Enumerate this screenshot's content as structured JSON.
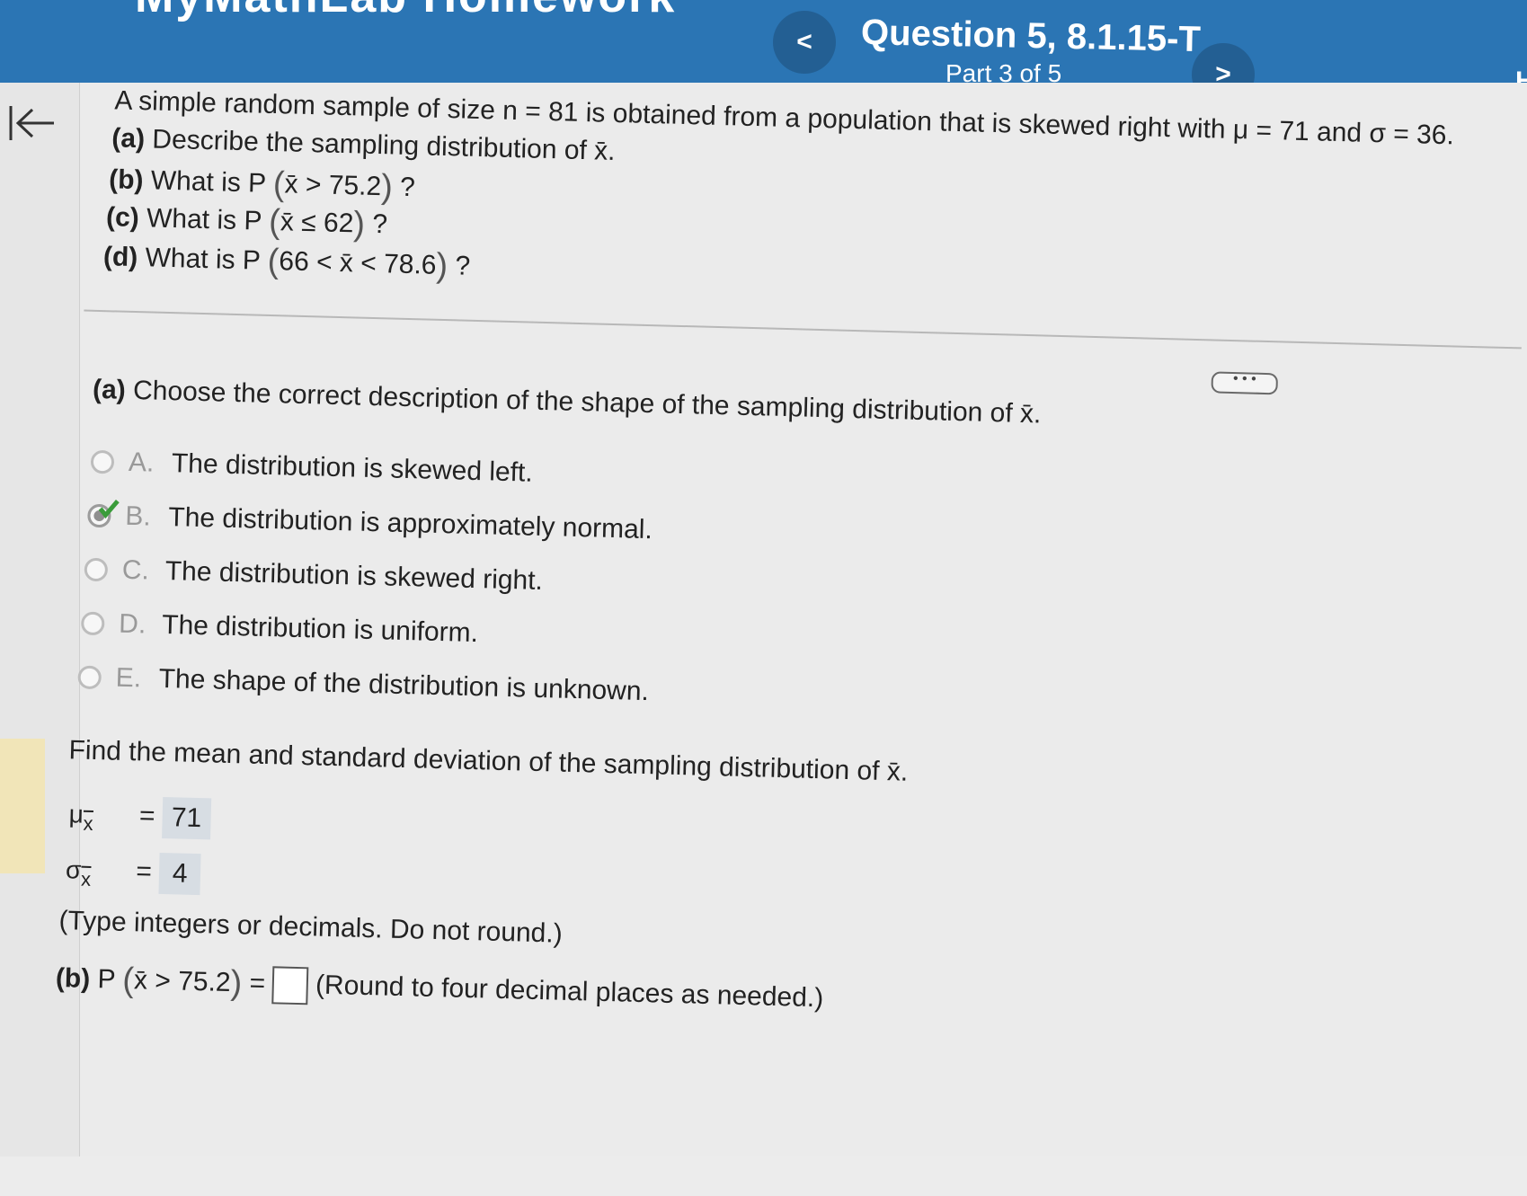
{
  "header": {
    "brand": "MyMathLab Homework",
    "question_title": "Question 5, 8.1.15-T",
    "part_label": "Part 3 of 5",
    "prev_label": "<",
    "next_label": ">",
    "corner_text": "H"
  },
  "problem": {
    "intro": "A simple random sample of size n = 81 is obtained from a population that is skewed right with μ = 71 and σ = 36.",
    "a_label": "(a)",
    "a_text": "Describe the sampling distribution of x̄.",
    "b_label": "(b)",
    "b_text": "What is P",
    "b_expr": "x̄ > 75.2",
    "c_label": "(c)",
    "c_text": "What is P",
    "c_expr": "x̄ ≤ 62",
    "d_label": "(d)",
    "d_text": "What is P",
    "d_expr": "66 < x̄ < 78.6",
    "qmark": "?"
  },
  "more_label": "• • •",
  "part_a": {
    "label": "(a)",
    "prompt": "Choose the correct description of the shape of the sampling distribution of x̄.",
    "options": [
      {
        "letter": "A.",
        "text": "The distribution is skewed left.",
        "selected": false
      },
      {
        "letter": "B.",
        "text": "The distribution is approximately normal.",
        "selected": true
      },
      {
        "letter": "C.",
        "text": "The distribution is skewed right.",
        "selected": false
      },
      {
        "letter": "D.",
        "text": "The distribution is uniform.",
        "selected": false
      },
      {
        "letter": "E.",
        "text": "The shape of the distribution is unknown.",
        "selected": false
      }
    ]
  },
  "mean_sd": {
    "prompt": "Find the mean and standard deviation of the sampling distribution of x̄.",
    "mu_symbol": "μ",
    "sigma_symbol": "σ",
    "sub": "x",
    "equals": "=",
    "mu_value": "71",
    "sigma_value": "4",
    "hint": "(Type integers or decimals. Do not round.)"
  },
  "part_b": {
    "label": "(b)",
    "p": "P",
    "expr": "x̄ > 75.2",
    "equals": "=",
    "instruction": "(Round to four decimal places as needed.)"
  },
  "colors": {
    "header": "#2b75b4",
    "check": "#3a9c3a",
    "field": "#d7dde3"
  }
}
